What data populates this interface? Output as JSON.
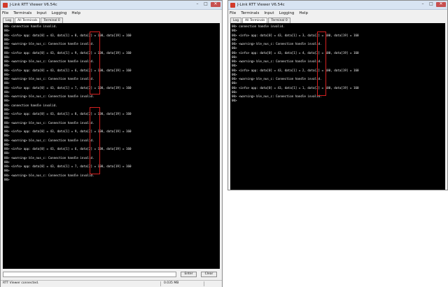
{
  "windows": [
    {
      "title": "J-Link RTT Viewer V6.54c",
      "menu": [
        "File",
        "Terminals",
        "Input",
        "Logging",
        "Help"
      ],
      "tabs": [
        "Log",
        "All Terminals",
        "Terminal 0"
      ],
      "active_tab": 1,
      "lines": [
        "00> connection handle invalid.",
        "00>",
        "00> <info> app: data[0] = 43, data[1] = 8, data[2] = 100, data[19] = 160",
        "00>",
        "00> <warning> ble_nus_c: Connection handle invalid.",
        "00>",
        "00> <info> app: data[0] = 43, data[1] = 9, data[2] = 100, data[19] = 160",
        "00>",
        "00> <warning> ble_nus_c: Connection handle invalid.",
        "00>",
        "00> <info> app: data[0] = 43, data[1] = 6, data[2] = 100, data[19] = 160",
        "00>",
        "00> <warning> ble_nus_c: Connection handle invalid.",
        "00>",
        "00> <info> app: data[0] = 43, data[1] = 7, data[2] = 100, data[19] = 160",
        "00>",
        "00> <warning> ble_nus_c: Connection handle invalid.",
        "00>",
        "00> connection handle invalid.",
        "00>",
        "00> <info> app: data[0] = 43, data[1] = 8, data[2] = 100, data[19] = 160",
        "00>",
        "00> <warning> ble_nus_c: Connection handle invalid.",
        "00>",
        "00> <info> app: data[0] = 43, data[1] = 9, data[2] = 100, data[19] = 160",
        "00>",
        "00> <warning> ble_nus_c: Connection handle invalid.",
        "00>",
        "00> <info> app: data[0] = 43, data[1] = 6, data[2] = 100, data[19] = 160",
        "00>",
        "00> <warning> ble_nus_c: Connection handle invalid.",
        "00>",
        "00> <info> app: data[0] = 43, data[1] = 7, data[2] = 100, data[19] = 160",
        "00>",
        "00> <warning> ble_nus_c: Connection handle invalid.",
        "00>"
      ],
      "buttons": {
        "enter": "Enter",
        "clear": "Clear"
      },
      "status": {
        "text": "RTT Viewer connected.",
        "size": "0.035 MB"
      }
    },
    {
      "title": "J-Link RTT Viewer V6.54c",
      "menu": [
        "File",
        "Terminals",
        "Input",
        "Logging",
        "Help"
      ],
      "tabs": [
        "Log",
        "All Terminals",
        "Terminal 0"
      ],
      "active_tab": 1,
      "lines": [
        "00> connection handle invalid.",
        "00>",
        "00> <info> app: data[0] = 43, data[1] = 3, data[2] = 100, data[19] = 160",
        "00>",
        "00> <warning> ble_nus_c: Connection handle invalid.",
        "00>",
        "00> <info> app: data[0] = 43, data[1] = 4, data[2] = 100, data[19] = 160",
        "00>",
        "00> <warning> ble_nus_c: Connection handle invalid.",
        "00>",
        "00> <info> app: data[0] = 43, data[1] = 2, data[2] = 100, data[19] = 160",
        "00>",
        "00> <warning> ble_nus_c: Connection handle invalid.",
        "00>",
        "00> <info> app: data[0] = 43, data[1] = 1, data[2] = 100, data[19] = 160",
        "00>",
        "00> <warning> ble_nus_c: Connection handle invalid.",
        "00>"
      ]
    }
  ],
  "colors": {
    "console_bg": "#000000",
    "console_text": "#f2f2f2",
    "highlight": "#d42020"
  }
}
